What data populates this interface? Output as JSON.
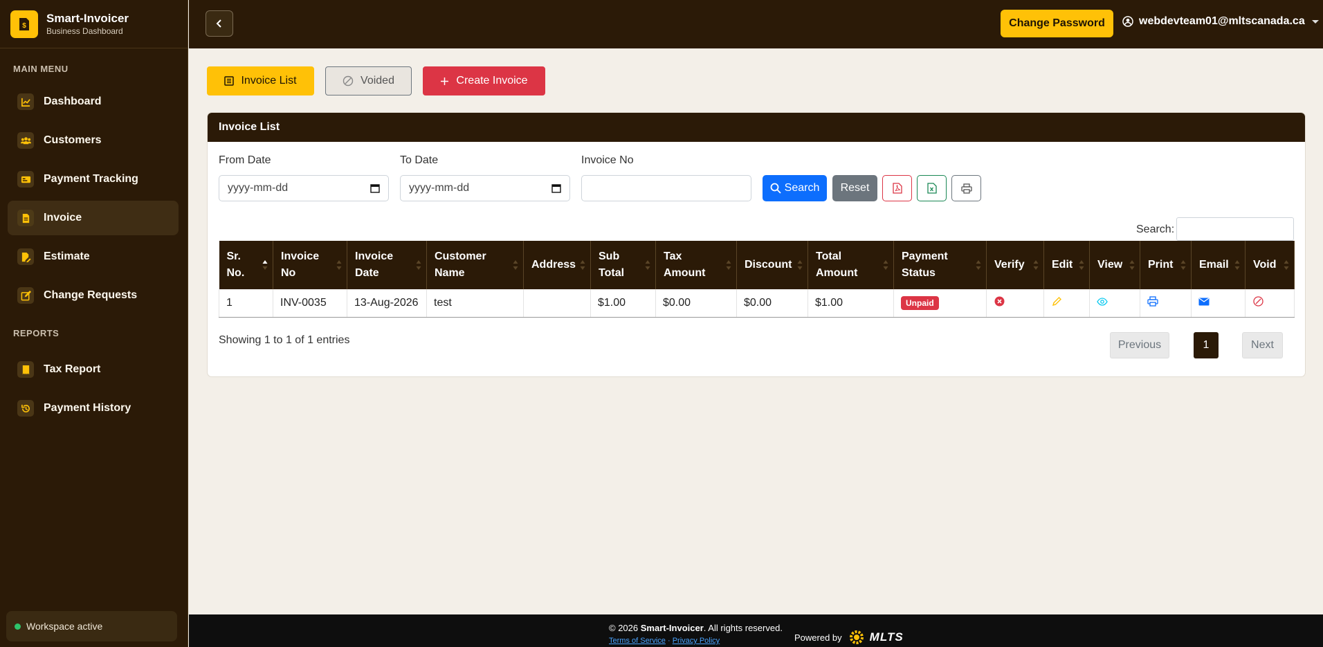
{
  "brand": {
    "title": "Smart-Invoicer",
    "subtitle": "Business Dashboard"
  },
  "sidebar": {
    "main_menu_title": "MAIN MENU",
    "reports_title": "REPORTS",
    "items": [
      {
        "label": "Dashboard",
        "icon": "chart-line-icon"
      },
      {
        "label": "Customers",
        "icon": "users-icon"
      },
      {
        "label": "Payment Tracking",
        "icon": "card-icon"
      },
      {
        "label": "Invoice",
        "icon": "file-icon",
        "active": true
      },
      {
        "label": "Estimate",
        "icon": "file-edit-icon"
      },
      {
        "label": "Change Requests",
        "icon": "pencil-square-icon"
      }
    ],
    "report_items": [
      {
        "label": "Tax Report",
        "icon": "receipt-icon"
      },
      {
        "label": "Payment History",
        "icon": "history-icon"
      }
    ],
    "workspace_status": "Workspace active"
  },
  "topbar": {
    "change_password": "Change Password",
    "user_email": "webdevteam01@mltscanada.ca"
  },
  "tabs": {
    "invoice_list": "Invoice List",
    "voided": "Voided",
    "create_invoice": "Create Invoice"
  },
  "card": {
    "title": "Invoice List",
    "filters": {
      "from_date_label": "From Date",
      "from_date_value": "yyyy-mm-dd",
      "to_date_label": "To Date",
      "to_date_value": "yyyy-mm-dd",
      "invoice_no_label": "Invoice No",
      "invoice_no_value": ""
    },
    "buttons": {
      "search": "Search",
      "reset": "Reset"
    },
    "search_label": "Search:"
  },
  "table": {
    "headers": [
      [
        "Sr.",
        "No."
      ],
      [
        "Invoice",
        "No"
      ],
      [
        "Invoice",
        "Date"
      ],
      [
        "Customer",
        "Name"
      ],
      [
        "Address"
      ],
      [
        "Sub",
        "Total"
      ],
      [
        "Tax",
        "Amount"
      ],
      [
        "Discount"
      ],
      [
        "Total",
        "Amount"
      ],
      [
        "Payment",
        "Status"
      ],
      [
        "Verify"
      ],
      [
        "Edit"
      ],
      [
        "View"
      ],
      [
        "Print"
      ],
      [
        "Email"
      ],
      [
        "Void"
      ]
    ],
    "rows": [
      {
        "sr": "1",
        "invoice_no": "INV-0035",
        "date": "13-Aug-2026",
        "customer": "test",
        "address": "",
        "sub_total": "$1.00",
        "tax": "$0.00",
        "discount": "$0.00",
        "total": "$1.00",
        "status": "Unpaid"
      }
    ],
    "showing": "Showing 1 to 1 of 1 entries",
    "pagination": {
      "previous": "Previous",
      "current": "1",
      "next": "Next"
    }
  },
  "footer": {
    "copy_prefix": "© 2026 ",
    "copy_brand": "Smart-Invoicer",
    "copy_suffix": ". All rights reserved.",
    "terms": "Terms of Service",
    "sep": "·",
    "privacy": "Privacy Policy",
    "powered_by": "Powered by",
    "logo_text": "MLTS"
  },
  "colors": {
    "brand_dark": "#2b1a07",
    "accent": "#ffc107",
    "danger": "#dc3545",
    "primary": "#0d6efd"
  }
}
